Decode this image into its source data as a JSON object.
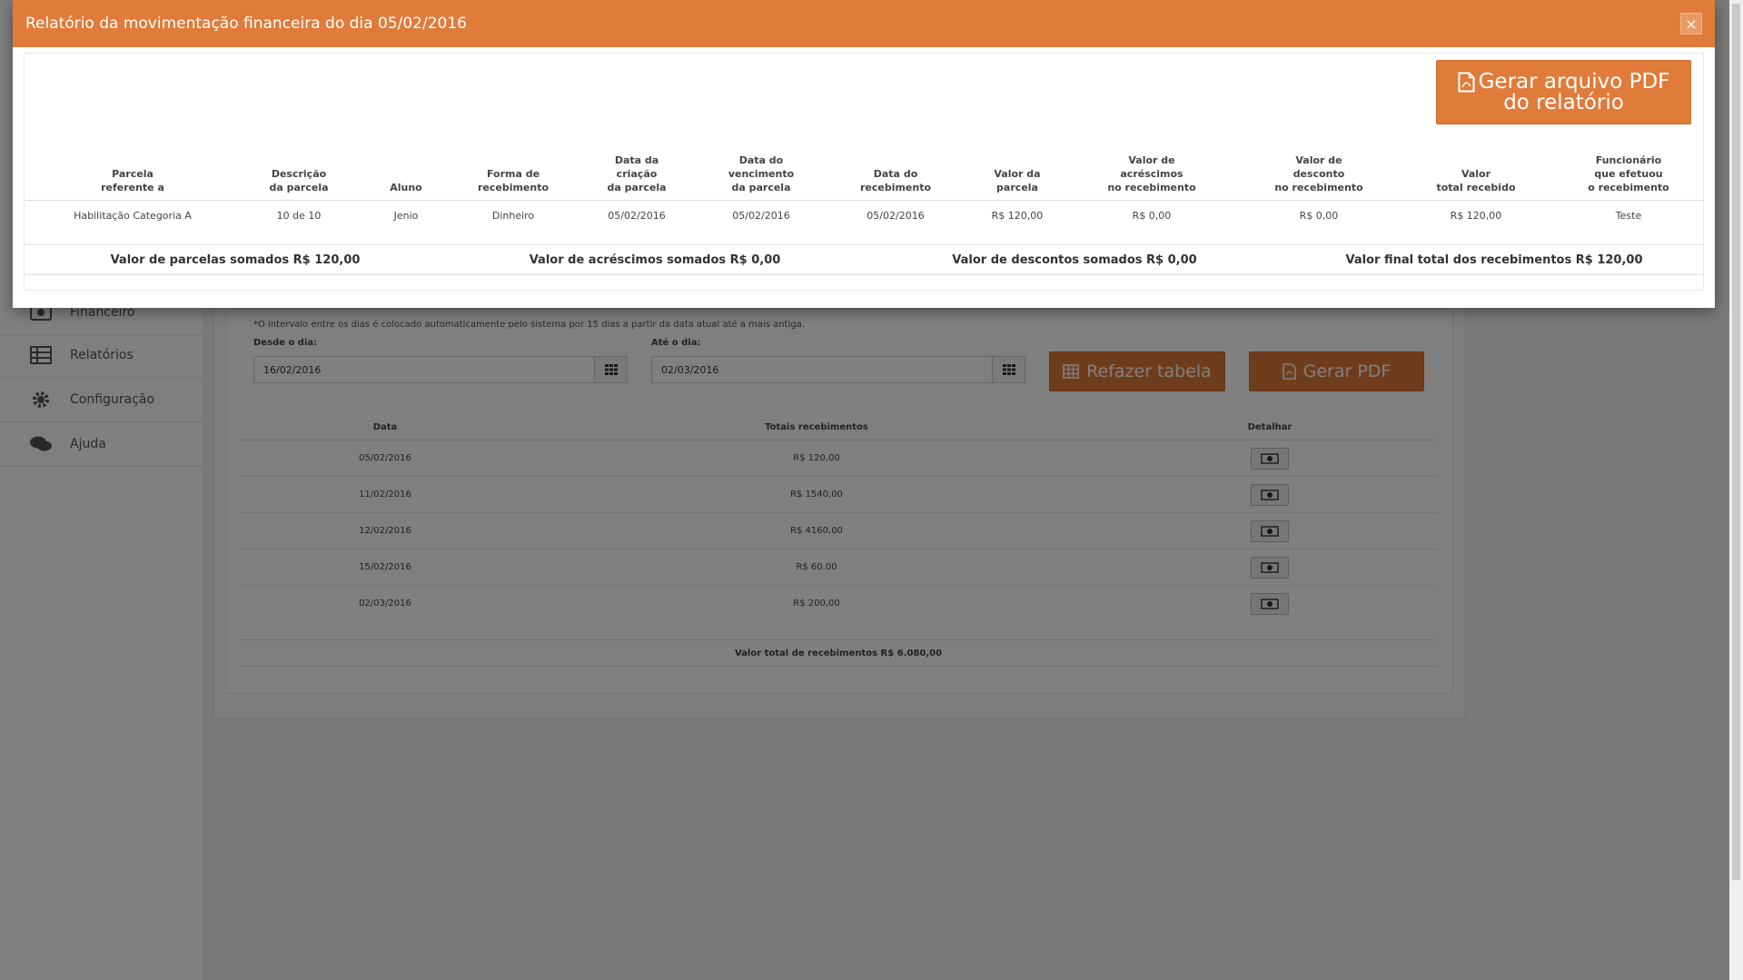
{
  "modal": {
    "title": "Relatório da movimentação financeira do dia 05/02/2016",
    "close_label": "×",
    "pdf_button_label": "Gerar arquivo PDF do relatório",
    "columns": [
      "Parcela\nreferente a",
      "Descrição\nda parcela",
      "Aluno",
      "Forma de\nrecebimento",
      "Data da\ncriação\nda parcela",
      "Data do\nvencimento\nda parcela",
      "Data do\nrecebimento",
      "Valor da\nparcela",
      "Valor de\nacréscimos\nno recebimento",
      "Valor de\ndesconto\nno recebimento",
      "Valor\ntotal recebido",
      "Funcionário\nque efetuou\no recebimento"
    ],
    "rows": [
      [
        "Habilitação Categoria A",
        "10 de 10",
        "Jenio",
        "Dinheiro",
        "05/02/2016",
        "05/02/2016",
        "05/02/2016",
        "R$ 120,00",
        "R$ 0,00",
        "R$ 0,00",
        "R$ 120,00",
        "Teste"
      ]
    ],
    "summary": {
      "parcelas": "Valor de parcelas somados R$ 120,00",
      "acrescimos": "Valor de acréscimos somados R$ 0,00",
      "descontos": "Valor de descontos somados R$ 0,00",
      "final": "Valor final total dos recebimentos R$ 120,00"
    }
  },
  "sidebar": {
    "items": [
      {
        "label": "Financeiro",
        "icon": "money-icon"
      },
      {
        "label": "Relatórios",
        "icon": "table-icon"
      },
      {
        "label": "Configuração",
        "icon": "gear-icon"
      },
      {
        "label": "Ajuda",
        "icon": "chat-icon"
      }
    ]
  },
  "filter": {
    "note": "*O intervalo entre os dias é colocado automaticamente pelo sistema por 15 dias a partir da data atual até a mais antiga.",
    "from_label": "Desde o dia:",
    "from_value": "16/02/2016",
    "to_label": "Até o dia:",
    "to_value": "02/03/2016",
    "redo_button": "Refazer tabela",
    "pdf_button": "Gerar PDF"
  },
  "receipts": {
    "headers": {
      "date": "Data",
      "totals": "Totais recebimentos",
      "detail": "Detalhar"
    },
    "rows": [
      {
        "date": "05/02/2016",
        "total": "R$ 120,00"
      },
      {
        "date": "11/02/2016",
        "total": "R$ 1540,00"
      },
      {
        "date": "12/02/2016",
        "total": "R$ 4160,00"
      },
      {
        "date": "15/02/2016",
        "total": "R$ 60,00"
      },
      {
        "date": "02/03/2016",
        "total": "R$ 200,00"
      }
    ],
    "total_label": "Valor total de recebimentos R$ 6.080,00"
  },
  "colors": {
    "accent": "#e07b39",
    "backdrop": "rgba(0,0,0,0.5)"
  }
}
